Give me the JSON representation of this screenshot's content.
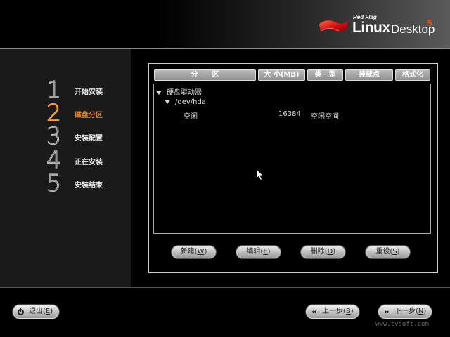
{
  "logo": {
    "small": "Red Flag",
    "linux": "Linux",
    "desktop": "Desktop",
    "version": "5"
  },
  "steps": [
    {
      "num": "1",
      "label": "开始安装",
      "active": false
    },
    {
      "num": "2",
      "label": "磁盘分区",
      "active": true
    },
    {
      "num": "3",
      "label": "安装配置",
      "active": false
    },
    {
      "num": "4",
      "label": "正在安装",
      "active": false
    },
    {
      "num": "5",
      "label": "安装结束",
      "active": false
    }
  ],
  "table": {
    "columns": [
      "分　　区",
      "大 小(MB)",
      "类　型",
      "挂载点",
      "格式化"
    ],
    "tree": {
      "root": "硬盘驱动器",
      "device": "/dev/hda",
      "partition": {
        "name": "空闲",
        "size": "16384",
        "type": "空闲空间"
      }
    }
  },
  "actions": {
    "new": {
      "label": "新建(",
      "key": "W",
      "end": ")"
    },
    "edit": {
      "label": "编辑(",
      "key": "E",
      "end": ")"
    },
    "delete": {
      "label": "删除(",
      "key": "D",
      "end": ")"
    },
    "reset": {
      "label": "重设(",
      "key": "S",
      "end": ")"
    }
  },
  "nav": {
    "exit": {
      "label": "退出(",
      "key": "E",
      "end": ")"
    },
    "back": {
      "icon": "«",
      "label": "上一步(",
      "key": "B",
      "end": ")"
    },
    "next": {
      "icon": "»",
      "label": "下一步(",
      "key": "N",
      "end": ")"
    }
  },
  "watermark": "www.tvsoft.com"
}
